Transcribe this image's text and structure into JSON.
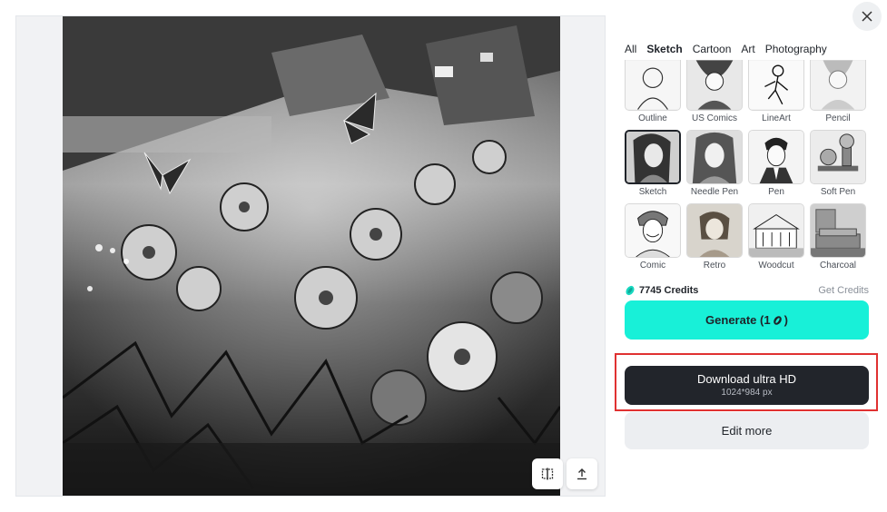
{
  "tabs": [
    {
      "label": "All",
      "active": false
    },
    {
      "label": "Sketch",
      "active": true
    },
    {
      "label": "Cartoon",
      "active": false
    },
    {
      "label": "Art",
      "active": false
    },
    {
      "label": "Photography",
      "active": false
    }
  ],
  "styles": [
    {
      "label": "Outline",
      "selected": false
    },
    {
      "label": "US Comics",
      "selected": false
    },
    {
      "label": "LineArt",
      "selected": false
    },
    {
      "label": "Pencil",
      "selected": false
    },
    {
      "label": "Sketch",
      "selected": true
    },
    {
      "label": "Needle Pen",
      "selected": false
    },
    {
      "label": "Pen",
      "selected": false
    },
    {
      "label": "Soft Pen",
      "selected": false
    },
    {
      "label": "Comic",
      "selected": false
    },
    {
      "label": "Retro",
      "selected": false
    },
    {
      "label": "Woodcut",
      "selected": false
    },
    {
      "label": "Charcoal",
      "selected": false
    }
  ],
  "credits": {
    "amount": "7745 Credits",
    "get_label": "Get Credits"
  },
  "generate": {
    "label": "Generate (1",
    "label_end": ")"
  },
  "download": {
    "title": "Download ultra HD",
    "resolution": "1024*984 px"
  },
  "edit": {
    "label": "Edit more"
  },
  "icons": {
    "close": "close-icon",
    "compare": "compare-icon",
    "share": "upload-icon",
    "credit": "credit-coin-icon"
  },
  "colors": {
    "accent": "#18f0d8",
    "dark_button": "#22252b",
    "highlight": "#e03131"
  }
}
